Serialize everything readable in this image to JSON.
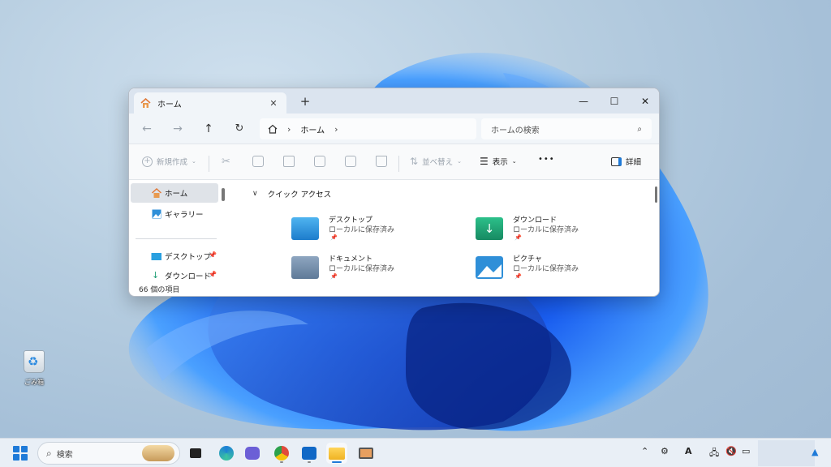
{
  "desktop": {
    "recycle_bin_label": "ごみ箱"
  },
  "window": {
    "tab_title": "ホーム",
    "controls": {
      "minimize": "—",
      "maximize": "☐",
      "close": "✕",
      "new_tab": "+",
      "tab_close": "✕"
    },
    "nav": {
      "back": "←",
      "forward": "→",
      "up": "↑",
      "refresh": "↻",
      "address_home_icon": "home-icon",
      "address_path": [
        "ホーム"
      ],
      "search_placeholder": "ホームの検索"
    },
    "toolbar": {
      "new_label": "新規作成",
      "sort_label": "並べ替え",
      "view_label": "表示",
      "more_label": "•••",
      "details_label": "詳細"
    },
    "sidebar": {
      "items": [
        {
          "label": "ホーム",
          "icon": "home-icon",
          "selected": true
        },
        {
          "label": "ギャラリー",
          "icon": "gallery-icon"
        },
        {
          "label": "デスクトップ",
          "icon": "desktop-icon",
          "pinned": true
        },
        {
          "label": "ダウンロード",
          "icon": "download-icon",
          "pinned": true
        }
      ]
    },
    "quick_access": {
      "heading": "クイック アクセス",
      "items": [
        {
          "name": "デスクトップ",
          "sub": "ローカルに保存済み",
          "color": "#2a8fd6"
        },
        {
          "name": "ダウンロード",
          "sub": "ローカルに保存済み",
          "color": "#1f9e74"
        },
        {
          "name": "ドキュメント",
          "sub": "ローカルに保存済み",
          "color": "#6e8aa8"
        },
        {
          "name": "ピクチャ",
          "sub": "ローカルに保存済み",
          "color": "#2f8fd8"
        }
      ]
    },
    "status": "66 個の項目"
  },
  "taskbar": {
    "search_label": "検索",
    "accent": "#1e7ad8"
  },
  "colors": {
    "accent": "#1e7ad8",
    "window_bg": "#ffffff",
    "titlebar": "#dbe4ef"
  }
}
